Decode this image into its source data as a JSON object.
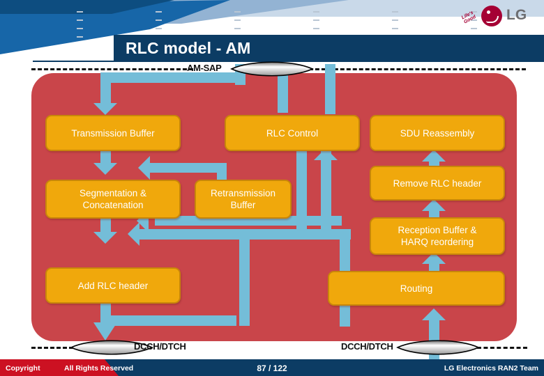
{
  "brand": {
    "logo_text": "LG",
    "slogan": "Life's Good"
  },
  "slide": {
    "title": "RLC model - AM"
  },
  "diagram": {
    "sap_top_label": "AM-SAP",
    "sap_bottom_left_label": "DCCH/DTCH",
    "sap_bottom_right_label": "DCCH/DTCH",
    "colors": {
      "container": "#c9454a",
      "block": "#f0a80c",
      "block_border": "#c8860a",
      "connector": "#74bdd8",
      "title_bar": "#0c3c64",
      "brand_red": "#a50034"
    },
    "blocks": [
      {
        "id": "transmission-buffer",
        "label": "Transmission Buffer"
      },
      {
        "id": "rlc-control",
        "label": "RLC Control"
      },
      {
        "id": "sdu-reassembly",
        "label": "SDU Reassembly"
      },
      {
        "id": "segmentation-concatenation",
        "label": "Segmentation &\nConcatenation"
      },
      {
        "id": "retransmission-buffer",
        "label": "Retransmission\nBuffer"
      },
      {
        "id": "remove-rlc-header",
        "label": "Remove RLC header"
      },
      {
        "id": "reception-buffer-harq",
        "label": "Reception Buffer &\nHARQ reordering"
      },
      {
        "id": "add-rlc-header",
        "label": "Add RLC header"
      },
      {
        "id": "routing",
        "label": "Routing"
      }
    ]
  },
  "footer": {
    "copyright": "Copyright",
    "rights": "All Rights Reserved",
    "page": "87 / 122",
    "team": "LG Electronics RAN2 Team"
  }
}
